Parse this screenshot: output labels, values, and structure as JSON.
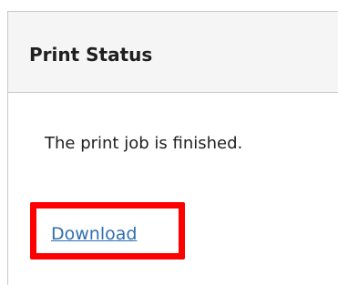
{
  "panel": {
    "title": "Print Status",
    "message": "The print job is finished.",
    "download_label": "Download"
  },
  "colors": {
    "header_bg": "#f5f5f5",
    "border": "#c8c8c8",
    "link": "#2f6fb0",
    "highlight": "#ff0000",
    "text": "#1f1f1f"
  }
}
